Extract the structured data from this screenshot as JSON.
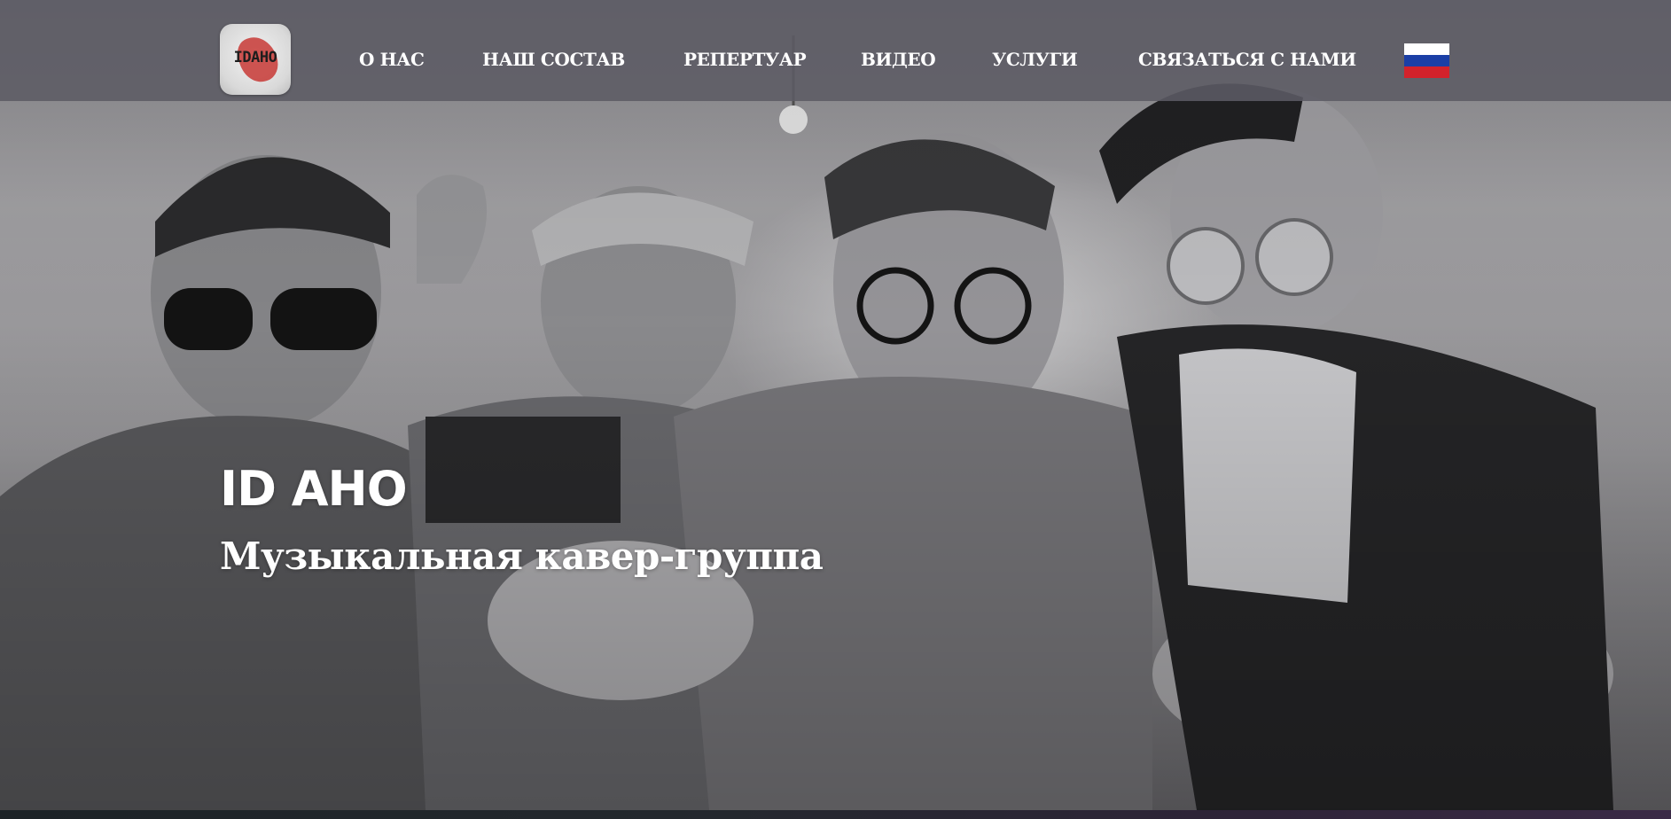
{
  "header": {
    "logo_text": "IDAHO",
    "nav": [
      {
        "label": "О НАС"
      },
      {
        "label": "НАШ СОСТАВ"
      },
      {
        "label": "РЕПЕРТУАР"
      },
      {
        "label": "ВИДЕО"
      },
      {
        "label": "УСЛУГИ"
      },
      {
        "label": "СВЯЗАТЬСЯ С НАМИ"
      }
    ],
    "language_icon": "russian-flag-icon"
  },
  "hero": {
    "title": "ID AHO",
    "subtitle": "Музыкальная кавер-группа",
    "image": "band-photo"
  }
}
